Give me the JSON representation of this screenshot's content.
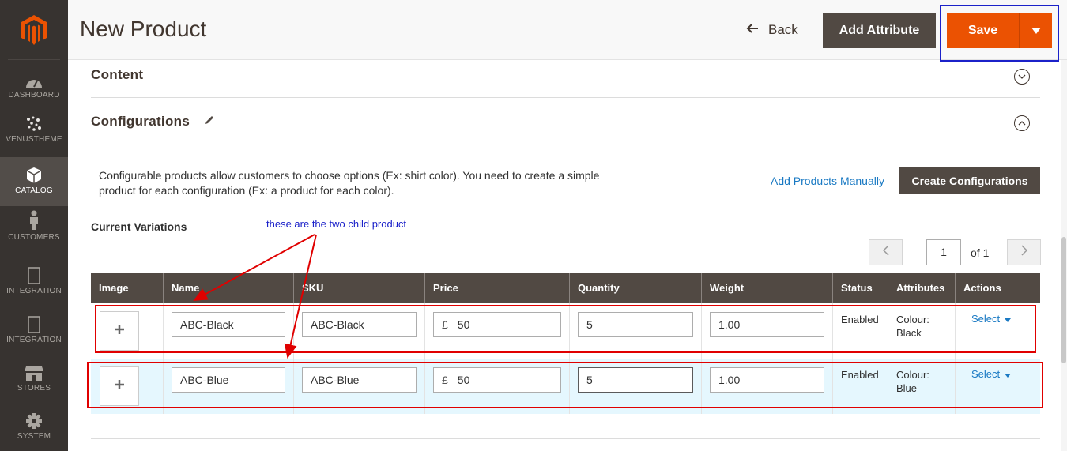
{
  "sidebar": {
    "items": [
      {
        "label": "DASHBOARD",
        "icon": "dashboard-icon"
      },
      {
        "label": "VENUSTHEME",
        "icon": "venustheme-icon"
      },
      {
        "label": "CATALOG",
        "icon": "box-icon",
        "active": true
      },
      {
        "label": "CUSTOMERS",
        "icon": "person-icon"
      },
      {
        "label": "INTEGRATION",
        "icon": "integration-icon"
      },
      {
        "label": "INTEGRATION",
        "icon": "integration-icon"
      },
      {
        "label": "STORES",
        "icon": "store-icon"
      },
      {
        "label": "SYSTEM",
        "icon": "gear-icon"
      }
    ]
  },
  "header": {
    "title": "New Product",
    "back_label": "Back",
    "add_attribute_label": "Add Attribute",
    "save_label": "Save"
  },
  "sections": {
    "content_title": "Content",
    "configurations_title": "Configurations"
  },
  "configurations": {
    "description": "Configurable products allow customers to choose options (Ex: shirt color). You need to create a simple product for each configuration (Ex: a product for each color).",
    "add_manually_label": "Add Products Manually",
    "create_label": "Create Configurations",
    "current_variations_label": "Current Variations",
    "annotation": "these are the two child product"
  },
  "pager": {
    "current": "1",
    "of_label": "of 1"
  },
  "table": {
    "headers": [
      "Image",
      "Name",
      "SKU",
      "Price",
      "Quantity",
      "Weight",
      "Status",
      "Attributes",
      "Actions"
    ],
    "rows": [
      {
        "name": "ABC-Black",
        "sku": "ABC-Black",
        "currency": "£",
        "price": "50",
        "quantity": "5",
        "weight": "1.00",
        "status": "Enabled",
        "attr_line1": "Colour:",
        "attr_line2": "Black",
        "action": "Select"
      },
      {
        "name": "ABC-Blue",
        "sku": "ABC-Blue",
        "currency": "£",
        "price": "50",
        "quantity": "5",
        "weight": "1.00",
        "status": "Enabled",
        "attr_line1": "Colour:",
        "attr_line2": "Blue",
        "action": "Select"
      }
    ]
  },
  "colors": {
    "sidebar": "#373330",
    "accent_orange": "#eb5202",
    "dark_button": "#514943",
    "link_blue": "#1979c3",
    "annotation_red": "#e00000",
    "annotation_blue": "#1b21c9"
  }
}
